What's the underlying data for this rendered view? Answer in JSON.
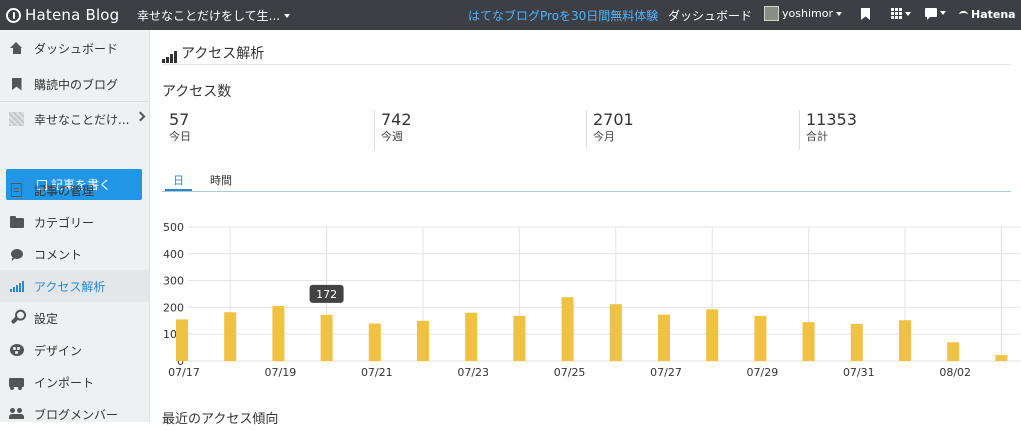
{
  "topbar": {
    "logo_text": "Hatena Blog",
    "blog_name": "幸せなことだけをして生...",
    "pro_link": "はてなブログProを30日間無料体験",
    "dashboard_link": "ダッシュボード",
    "username": "yoshimor",
    "hatena": "Hatena",
    "colors": {
      "bar": "#3d3f44",
      "link": "#4fb3ff"
    }
  },
  "sidebar": {
    "items": [
      {
        "label": "ダッシュボード",
        "icon": "home-icon"
      },
      {
        "label": "購読中のブログ",
        "icon": "bookmark-icon"
      },
      {
        "label": "幸せなことだけ...",
        "icon": "blog-thumbnail-icon"
      },
      {
        "label": "記事の管理",
        "icon": "document-icon"
      },
      {
        "label": "カテゴリー",
        "icon": "folder-icon"
      },
      {
        "label": "コメント",
        "icon": "comment-icon"
      },
      {
        "label": "アクセス解析",
        "icon": "bar-chart-icon",
        "active": true
      },
      {
        "label": "設定",
        "icon": "wrench-icon"
      },
      {
        "label": "デザイン",
        "icon": "palette-icon"
      },
      {
        "label": "インポート",
        "icon": "truck-icon"
      },
      {
        "label": "ブログメンバー",
        "icon": "people-icon"
      }
    ],
    "write_button": "記事を書く",
    "accent": "#2196e6"
  },
  "main": {
    "page_title": "アクセス解析",
    "section_title": "アクセス数",
    "stats": [
      {
        "value": "57",
        "label": "今日"
      },
      {
        "value": "742",
        "label": "今週"
      },
      {
        "value": "2701",
        "label": "今月"
      },
      {
        "value": "11353",
        "label": "合計"
      }
    ],
    "tabs": [
      {
        "label": "日",
        "active": true
      },
      {
        "label": "時間"
      }
    ],
    "tooltip": "172",
    "bottom_title": "最近のアクセス傾向"
  },
  "chart_data": {
    "type": "bar",
    "x_tick_labels": [
      "07/17",
      "07/19",
      "07/21",
      "07/23",
      "07/25",
      "07/27",
      "07/29",
      "07/31",
      "08/02"
    ],
    "categories": [
      "07/17",
      "07/18",
      "07/19",
      "07/20",
      "07/21",
      "07/22",
      "07/23",
      "07/24",
      "07/25",
      "07/26",
      "07/27",
      "07/28",
      "07/29",
      "07/30",
      "07/31",
      "08/01",
      "08/02",
      "08/03"
    ],
    "values": [
      155,
      182,
      205,
      172,
      140,
      150,
      180,
      168,
      238,
      212,
      173,
      193,
      168,
      145,
      138,
      152,
      70,
      22
    ],
    "y_ticks": [
      0,
      100,
      200,
      300,
      400,
      500
    ],
    "ylim": [
      0,
      500
    ],
    "grid": true,
    "bar_color": "#f0c243"
  }
}
